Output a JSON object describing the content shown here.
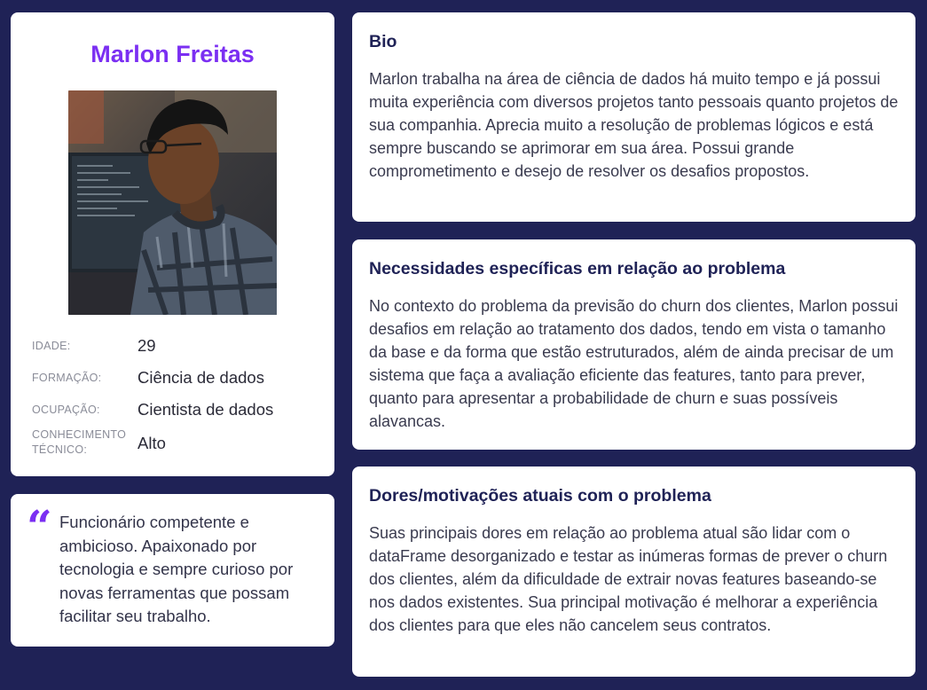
{
  "profile": {
    "name": "Marlon Freitas",
    "photo_icon": "person-at-computer-photo",
    "fields": [
      {
        "label": "IDADE:",
        "value": "29"
      },
      {
        "label": "FORMAÇÃO:",
        "value": "Ciência de dados"
      },
      {
        "label": "OCUPAÇÃO:",
        "value": "Cientista de dados"
      },
      {
        "label": "CONHECIMENTO TÉCNICO:",
        "value": "Alto"
      }
    ]
  },
  "quote": {
    "icon": "quote-icon",
    "text": "Funcionário competente e ambicioso. Apaixonado por tecnologia e sempre curioso por novas ferramentas que possam facilitar seu trabalho."
  },
  "bio": {
    "title": "Bio",
    "text": "Marlon trabalha na área de ciência de dados há muito tempo e já possui muita experiência com diversos projetos tanto pessoais quanto projetos de sua companhia. Aprecia muito a resolução de problemas lógicos e está sempre buscando se aprimorar em sua área. Possui grande comprometimento e desejo de resolver os desafios propostos."
  },
  "needs": {
    "title": "Necessidades específicas em relação ao problema",
    "text": "No contexto do problema da previsão do churn dos clientes, Marlon possui desafios em relação ao tratamento dos dados, tendo em vista o tamanho da base e da forma que estão estruturados, além de ainda precisar de um sistema que faça a avaliação eficiente das features, tanto para prever, quanto para apresentar a probabilidade de churn e suas possíveis alavancas."
  },
  "pains": {
    "title": "Dores/motivações atuais com o problema",
    "text": "Suas principais dores em relação ao problema atual são lidar com o dataFrame desorganizado e testar as inúmeras formas de prever o churn dos clientes, além da dificuldade de extrair novas features baseando-se nos dados existentes. Sua principal motivação é melhorar a experiência dos clientes para que eles não cancelem seus contratos."
  },
  "colors": {
    "background": "#1f2256",
    "accent": "#7b2ff2",
    "card": "#ffffff"
  }
}
